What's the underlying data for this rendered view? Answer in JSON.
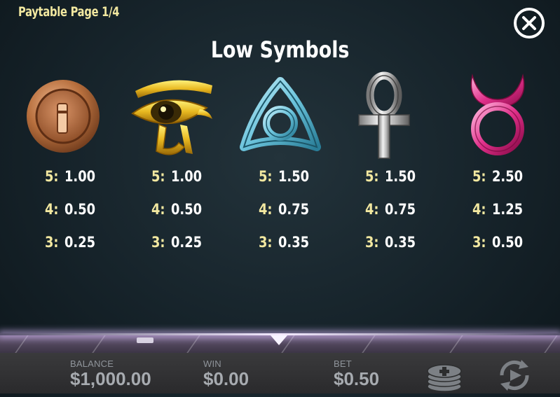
{
  "header": {
    "page_label": "Paytable Page 1/4",
    "title": "Low Symbols"
  },
  "symbols": [
    {
      "icon": "bronze-coin-icon",
      "pays": [
        {
          "k": "5:",
          "v": "1.00"
        },
        {
          "k": "4:",
          "v": "0.50"
        },
        {
          "k": "3:",
          "v": "0.25"
        }
      ]
    },
    {
      "icon": "eye-of-horus-icon",
      "pays": [
        {
          "k": "5:",
          "v": "1.00"
        },
        {
          "k": "4:",
          "v": "0.50"
        },
        {
          "k": "3:",
          "v": "0.25"
        }
      ]
    },
    {
      "icon": "triquetra-icon",
      "pays": [
        {
          "k": "5:",
          "v": "1.50"
        },
        {
          "k": "4:",
          "v": "0.75"
        },
        {
          "k": "3:",
          "v": "0.35"
        }
      ]
    },
    {
      "icon": "ankh-icon",
      "pays": [
        {
          "k": "5:",
          "v": "1.50"
        },
        {
          "k": "4:",
          "v": "0.75"
        },
        {
          "k": "3:",
          "v": "0.35"
        }
      ]
    },
    {
      "icon": "taurus-symbol-icon",
      "pays": [
        {
          "k": "5:",
          "v": "2.50"
        },
        {
          "k": "4:",
          "v": "1.25"
        },
        {
          "k": "3:",
          "v": "0.50"
        }
      ]
    }
  ],
  "footer": {
    "balance_label": "BALANCE",
    "balance_value": "$1,000.00",
    "win_label": "WIN",
    "win_value": "$0.00",
    "bet_label": "BET",
    "bet_value": "$0.50"
  },
  "colors": {
    "accent_yellow": "#f2e8a0",
    "coin_bronze": "#c07a4a",
    "eye_gold": "#e8b820",
    "triquetra_blue": "#6cc4dc",
    "ankh_silver": "#c8c8c8",
    "taurus_pink": "#e0308a"
  }
}
